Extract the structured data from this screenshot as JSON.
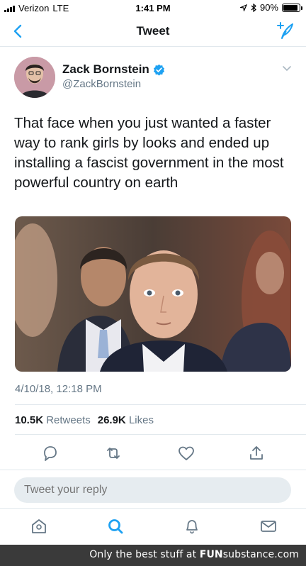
{
  "status_bar": {
    "carrier": "Verizon",
    "network": "LTE",
    "time": "1:41 PM",
    "battery_percent": "90%",
    "battery_level": 0.9
  },
  "nav": {
    "title": "Tweet"
  },
  "tweet": {
    "author_name": "Zack Bornstein",
    "handle": "@ZackBornstein",
    "text": "That face when you just wanted a faster way to rank girls by looks and ended up installing a fascist government in the most powerful country on earth",
    "timestamp": "4/10/18, 12:18 PM",
    "retweets_count": "10.5K",
    "retweets_label": "Retweets",
    "likes_count": "26.9K",
    "likes_label": "Likes"
  },
  "reply": {
    "placeholder": "Tweet your reply"
  },
  "watermark": {
    "prefix": "Only the best stuff at",
    "brand_fun": "FUN",
    "brand_rest": "substance.com"
  },
  "colors": {
    "accent": "#1da1f2",
    "secondary_text": "#657786",
    "divider": "#e1e8ed"
  }
}
